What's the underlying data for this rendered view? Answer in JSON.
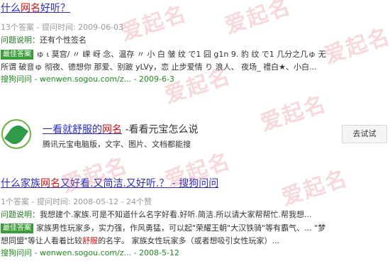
{
  "watermarks": [
    "爱起名",
    "爱起名",
    "爱起名",
    "爱起名",
    "爱起名",
    "爱起名",
    "爱起名",
    "爱起名"
  ],
  "result1": {
    "title_pre": "什么",
    "title_hl": "网名",
    "title_post": "好听？",
    "meta": "13个答案 - 提问时间: 2009-06-03",
    "desc_label": "问题说明：",
    "desc_text": "还有个性签名",
    "badge": "最佳答案",
    "answer_line1": "ゅ ι 莫宫/ 〃 嵘 岈 念、温存 〃 小 白 皱 纹 で1 囧 g1n 9. 豹 纹 で1 几分之几ゅ 无",
    "answer_line2": "所谓 破音ゅ 彻夜、德想你 那爱、别跛 yLVy，恋 止步爱情 り 浪人、 夜场_ 禮白★、小白...",
    "source_site": "搜狗问问",
    "source_url": " - wenwen.sogou.com/z... - 2009-6-3"
  },
  "ad": {
    "title_link_pre": "一看就舒服的",
    "title_link_hl": "网名",
    "title_rest": " -看看元宝怎么说",
    "desc": "腾讯元宝电脑版，文字、图片、文档都能搜",
    "button": "去试试"
  },
  "result2": {
    "title_pre": "什么家族",
    "title_hl": "网名",
    "title_post": "又好看.又简洁.又好听.？ - 搜狗问问",
    "meta": "1个答案 - 提问时间: 2008-05-12 - 24个赞",
    "desc_label": "问题说明：",
    "desc_text": "我想建个.家族.可是不知道什么名字好看.好听.简洁.所以请大家帮帮忙.帮我想...",
    "badge": "最佳答案",
    "answer_line1": "家族男性玩家多，实力强，作风勇猛，可以起\"荣耀王朝\"大汉铁骑\"等有霸气、... \"梦",
    "answer_line2_pre": "想同盟\"等让人看着比较",
    "answer_line2_hl": "舒服",
    "answer_line2_post": "的名字。 家族女性玩家多（或者想吸引女性玩家）...",
    "source_site": "搜狗问问",
    "source_url": " - wenwen.sogou.com/z... - 2008-5-12"
  }
}
